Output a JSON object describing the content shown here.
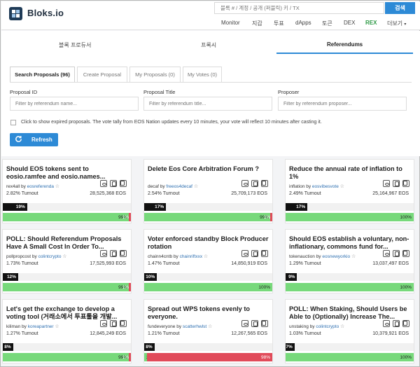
{
  "header": {
    "brand": "Bloks.io",
    "search_placeholder": "블록 # / 계정 / 공개 (퍼블릭) 키 / TX",
    "search_button": "검색",
    "nav": [
      "Monitor",
      "지갑",
      "투표",
      "dApps",
      "토큰",
      "DEX",
      "REX",
      "더보기"
    ]
  },
  "top_tabs": [
    "블록 프로듀서",
    "프록시",
    "Referendums"
  ],
  "sub_tabs": [
    "Search Proposals (96)",
    "Create Proposal",
    "My Proposals (0)",
    "My Votes (0)"
  ],
  "filters": {
    "proposal_id": {
      "label": "Proposal ID",
      "placeholder": "Filter by referendum name..."
    },
    "proposal_title": {
      "label": "Proposal Title",
      "placeholder": "Filter by referendum title..."
    },
    "proposer": {
      "label": "Proposer",
      "placeholder": "Filter by referendum proposer..."
    }
  },
  "expired_label": "Click to show expired proposals. The vote tally from EOS Nation updates every 10 minutes, your vote will reflect 10 minutes after casting it.",
  "refresh_label": "Refresh",
  "by_word": "by",
  "turnout_word": "Turnout",
  "star": "☆",
  "cards": [
    {
      "title": "Should EOS tokens sent to eosio.ramfee and eosio.names...",
      "id": "rex4all",
      "proposer": "eosreferenda",
      "turnout_pct": "2.82%",
      "eos": "28,525,368 EOS",
      "turnout_bar": 19,
      "turnout_bar_label": "19%",
      "yes": 99,
      "yes_label": "99%",
      "no": 1,
      "no_label": "1%"
    },
    {
      "title": "Delete Eos Core Arbitration Forum ?",
      "id": "decaf",
      "proposer": "freeos4decaf",
      "turnout_pct": "2.54%",
      "eos": "25,709,173 EOS",
      "turnout_bar": 17,
      "turnout_bar_label": "17%",
      "yes": 99,
      "yes_label": "99%",
      "no": 1,
      "no_label": "1%"
    },
    {
      "title": "Reduce the annual rate of inflation to 1%",
      "id": "inflation",
      "proposer": "eosvibesvote",
      "turnout_pct": "2.49%",
      "eos": "25,164,967 EOS",
      "turnout_bar": 17,
      "turnout_bar_label": "17%",
      "yes": 100,
      "yes_label": "100%",
      "no": 0,
      "no_label": ""
    },
    {
      "title": "POLL: Should Referendum Proposals Have A Small Cost In Order To...",
      "id": "pollpropcost",
      "proposer": "colintcrypto",
      "turnout_pct": "1.73%",
      "eos": "17,525,993 EOS",
      "turnout_bar": 12,
      "turnout_bar_label": "12%",
      "yes": 99,
      "yes_label": "99%",
      "no": 1,
      "no_label": "1%"
    },
    {
      "title": "Voter enforced standby Block Producer rotation",
      "id": "chainn4cntb",
      "proposer": "chainriftxxx",
      "turnout_pct": "1.47%",
      "eos": "14,850,919 EOS",
      "turnout_bar": 10,
      "turnout_bar_label": "10%",
      "yes": 100,
      "yes_label": "100%",
      "no": 0,
      "no_label": ""
    },
    {
      "title": "Should EOS establish a voluntary, non-inflationary, commons fund for...",
      "id": "tokenauction",
      "proposer": "eosnewyorkio",
      "turnout_pct": "1.29%",
      "eos": "13,037,497 EOS",
      "turnout_bar": 9,
      "turnout_bar_label": "9%",
      "yes": 100,
      "yes_label": "100%",
      "no": 0,
      "no_label": ""
    },
    {
      "title": "Let's get the exchange to develop a voting tool (거래소에서 투표툴을 개발...",
      "id": "kiliman",
      "proposer": "koreapartner",
      "turnout_pct": "1.27%",
      "eos": "12,845,249 EOS",
      "turnout_bar": 8,
      "turnout_bar_label": "8%",
      "yes": 99,
      "yes_label": "99%",
      "no": 1,
      "no_label": "1%"
    },
    {
      "title": "Spread out WPS tokens evenly to everyone.",
      "id": "fundeveryone",
      "proposer": "scatterhwlst",
      "turnout_pct": "1.21%",
      "eos": "12,267,565 EOS",
      "turnout_bar": 8,
      "turnout_bar_label": "8%",
      "yes": 2,
      "yes_label": "2%",
      "no": 98,
      "no_label": "98%"
    },
    {
      "title": "POLL: When Staking, Should Users be Able to (Optionally) Increase The...",
      "id": "unstaking",
      "proposer": "colintcrypto",
      "turnout_pct": "1.03%",
      "eos": "10,379,921 EOS",
      "turnout_bar": 7,
      "turnout_bar_label": "7%",
      "yes": 100,
      "yes_label": "100%",
      "no": 0,
      "no_label": ""
    }
  ],
  "colors": {
    "accent": "#2d8ad6",
    "yes": "#77d97b",
    "no": "#e14b5a",
    "rex": "#2e9a46"
  }
}
